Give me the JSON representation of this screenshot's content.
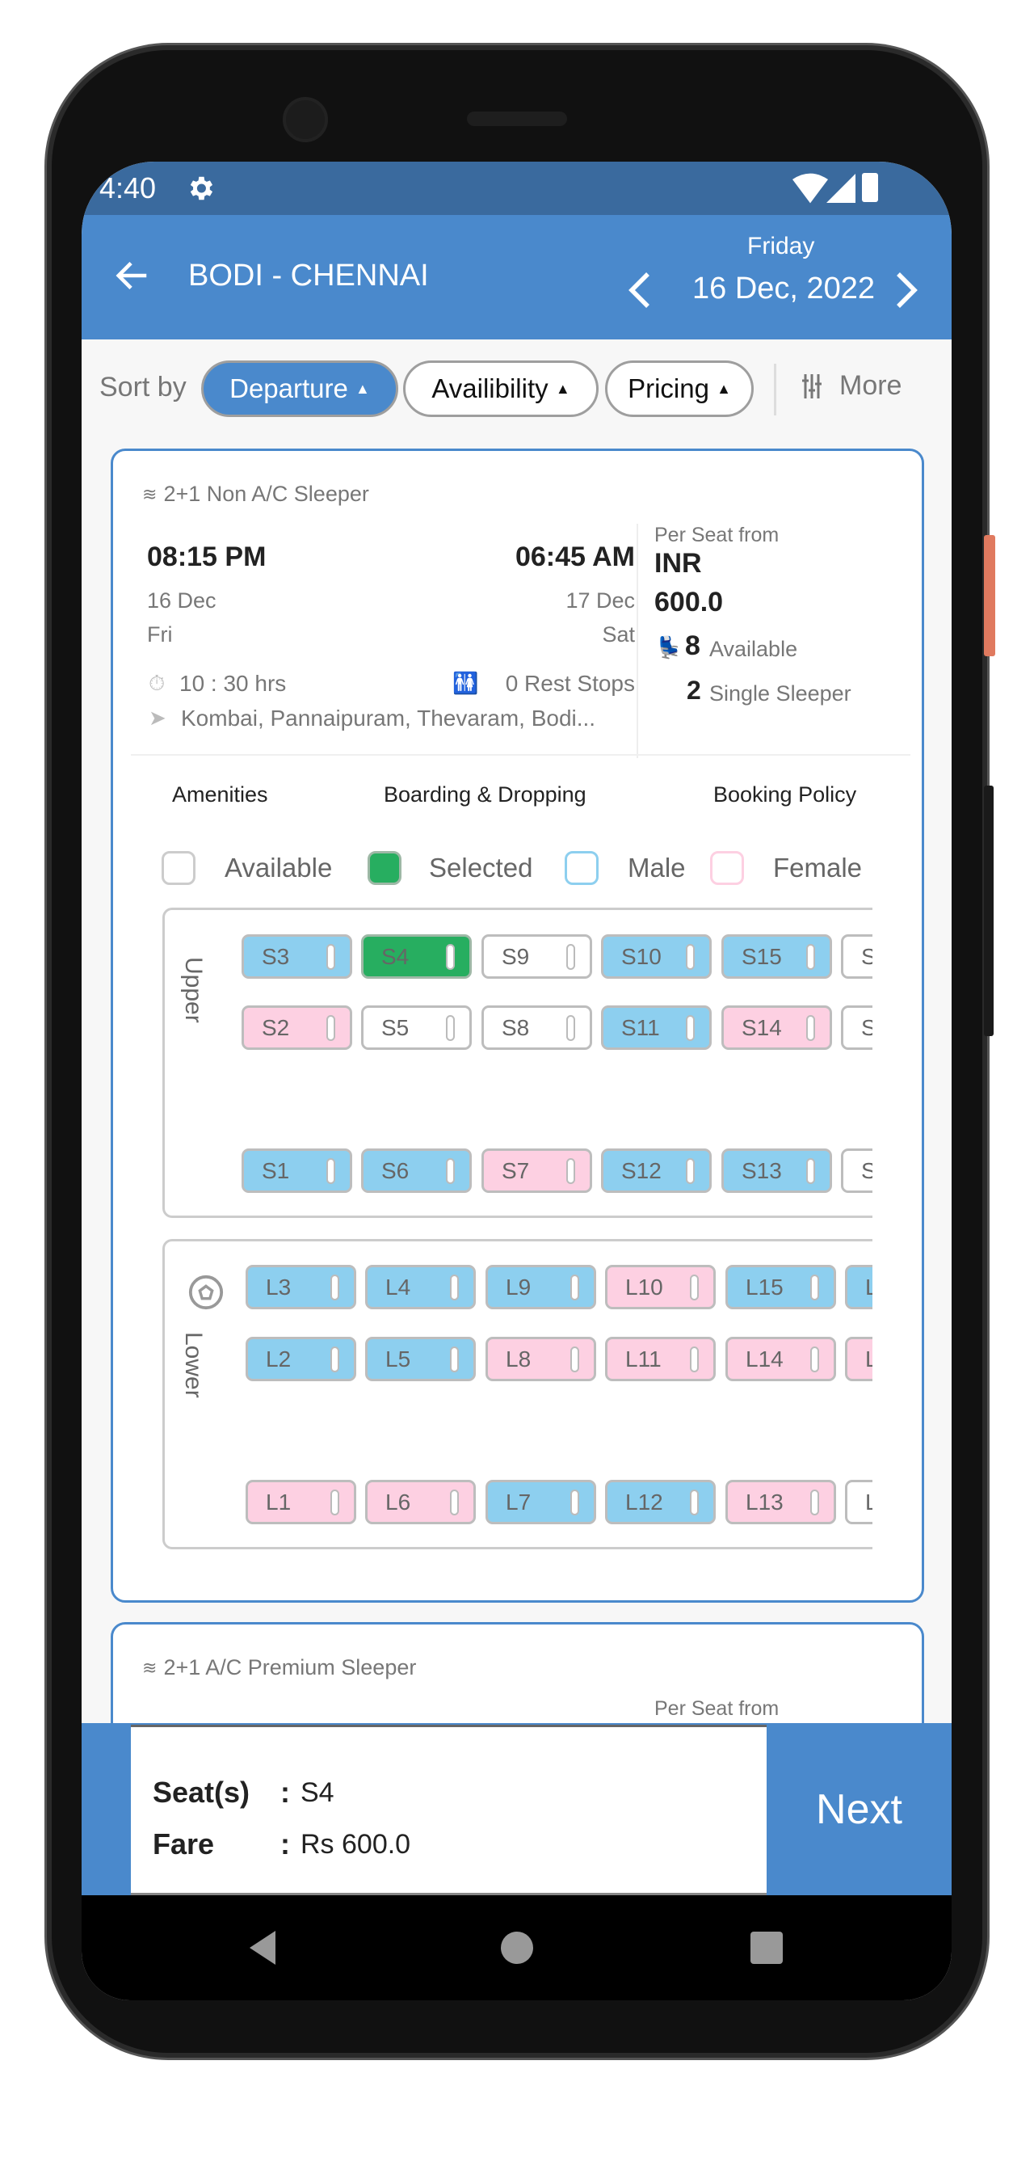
{
  "status_bar": {
    "time": "4:40",
    "icons": [
      "gear-icon",
      "wifi-icon",
      "signal-icon",
      "battery-icon"
    ]
  },
  "header": {
    "title": "BODI - CHENNAI",
    "day": "Friday",
    "date": "16 Dec, 2022",
    "back_icon": "arrow-left-icon"
  },
  "sort": {
    "label": "Sort by",
    "options": [
      {
        "label": "Departure",
        "active": true
      },
      {
        "label": "Availibility",
        "active": false
      },
      {
        "label": "Pricing",
        "active": false
      }
    ],
    "more_label": "More"
  },
  "colors": {
    "primary": "#4a89cc",
    "status_bar": "#3a6a9e",
    "selected": "#27ae60",
    "male": "#8dcfef",
    "female": "#fdd0e2",
    "available": "#ffffff"
  },
  "bus1": {
    "type": "2+1 Non A/C Sleeper",
    "departure_time": "08:15 PM",
    "departure_date": "16 Dec",
    "departure_day": "Fri",
    "arrival_time": "06:45 AM",
    "arrival_date": "17 Dec",
    "arrival_day": "Sat",
    "duration": "10 : 30 hrs",
    "rest_stops": "0 Rest Stops",
    "route": "Kombai, Pannaipuram, Thevaram, Bodi...",
    "price_label": "Per Seat from",
    "currency": "INR",
    "price": "600.0",
    "available_count": "8",
    "available_label": "Available",
    "single_count": "2",
    "single_label": "Single Sleeper",
    "tabs": [
      "Amenities",
      "Boarding & Dropping",
      "Booking Policy"
    ],
    "legend": [
      "Available",
      "Selected",
      "Male",
      "Female"
    ],
    "upper_label": "Upper",
    "lower_label": "Lower",
    "upper_rows": [
      [
        {
          "id": "S3",
          "s": "male"
        },
        {
          "id": "S4",
          "s": "selected"
        },
        {
          "id": "S9",
          "s": "available"
        },
        {
          "id": "S10",
          "s": "male"
        },
        {
          "id": "S15",
          "s": "male"
        },
        {
          "id": "S",
          "s": "available"
        }
      ],
      [
        {
          "id": "S2",
          "s": "female"
        },
        {
          "id": "S5",
          "s": "available"
        },
        {
          "id": "S8",
          "s": "available"
        },
        {
          "id": "S11",
          "s": "male"
        },
        {
          "id": "S14",
          "s": "female"
        },
        {
          "id": "S",
          "s": "available"
        }
      ],
      [
        {
          "id": "S1",
          "s": "male"
        },
        {
          "id": "S6",
          "s": "male"
        },
        {
          "id": "S7",
          "s": "female"
        },
        {
          "id": "S12",
          "s": "male"
        },
        {
          "id": "S13",
          "s": "male"
        },
        {
          "id": "S",
          "s": "available"
        }
      ]
    ],
    "lower_rows": [
      [
        {
          "id": "L3",
          "s": "male"
        },
        {
          "id": "L4",
          "s": "male"
        },
        {
          "id": "L9",
          "s": "male"
        },
        {
          "id": "L10",
          "s": "female"
        },
        {
          "id": "L15",
          "s": "male"
        },
        {
          "id": "L",
          "s": "male"
        }
      ],
      [
        {
          "id": "L2",
          "s": "male"
        },
        {
          "id": "L5",
          "s": "male"
        },
        {
          "id": "L8",
          "s": "female"
        },
        {
          "id": "L11",
          "s": "female"
        },
        {
          "id": "L14",
          "s": "female"
        },
        {
          "id": "L",
          "s": "female"
        }
      ],
      [
        {
          "id": "L1",
          "s": "female"
        },
        {
          "id": "L6",
          "s": "female"
        },
        {
          "id": "L7",
          "s": "male"
        },
        {
          "id": "L12",
          "s": "male"
        },
        {
          "id": "L13",
          "s": "female"
        },
        {
          "id": "L",
          "s": "available"
        }
      ]
    ]
  },
  "bus2": {
    "type": "2+1 A/C Premium Sleeper",
    "price_label": "Per Seat from"
  },
  "footer": {
    "seats_label": "Seat(s)",
    "seats_value": "S4",
    "fare_label": "Fare",
    "fare_value": "Rs 600.0",
    "next_label": "Next"
  }
}
